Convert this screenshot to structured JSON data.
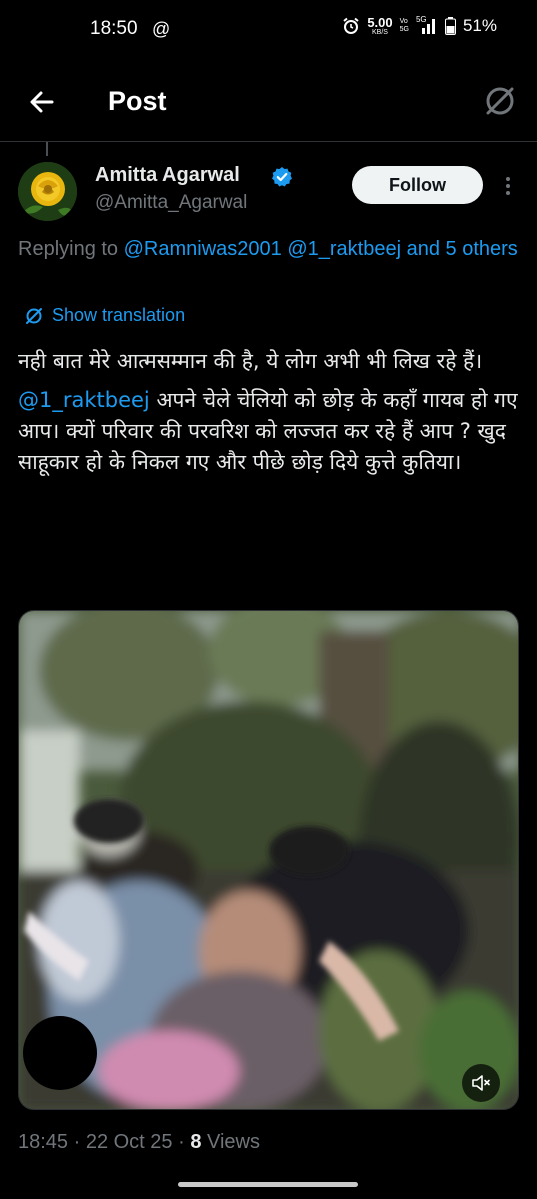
{
  "status_bar": {
    "time": "18:50",
    "at_symbol": "@",
    "speed_value": "5.00",
    "speed_unit": "KB/S",
    "vo_top": "Vo",
    "vo_bottom": "5G",
    "network": "5G",
    "battery": "51%"
  },
  "header": {
    "title": "Post"
  },
  "tweet": {
    "author_name": "Amitta Agarwal",
    "author_handle": "@Amitta_Agarwal",
    "follow_label": "Follow",
    "replying_prefix": "Replying to",
    "replying_mentions": "@Ramniwas2001 @1_raktbeej and 5 others",
    "show_translation": "Show translation",
    "text_line1": "नही बात मेरे आत्मसम्मान की है, ये लोग अभी भी लिख रहे हैं।",
    "mention": "@1_raktbeej",
    "text_line2": " अपने चेले चेलियो को छोड़ के कहाँ गायब हो गए आप। क्यों परिवार की परवरिश को लज्जत कर रहे हैं आप ? खुद साहूकार हो के निकल गए और पीछे छोड़ दिये कुत्ते कुतिया।",
    "meta_time": "18:45 · 22 Oct 25 · ",
    "views_count": "8",
    "views_label": " Views"
  },
  "colors": {
    "accent": "#1d9bf0",
    "background": "#000000",
    "text": "#e7e9ea",
    "secondary_text": "#71767b"
  },
  "icons": {
    "back": "arrow-left-icon",
    "translate": "translate-icon",
    "verified": "verified-badge-icon",
    "more": "more-vertical-icon",
    "mute": "volume-muted-icon"
  }
}
